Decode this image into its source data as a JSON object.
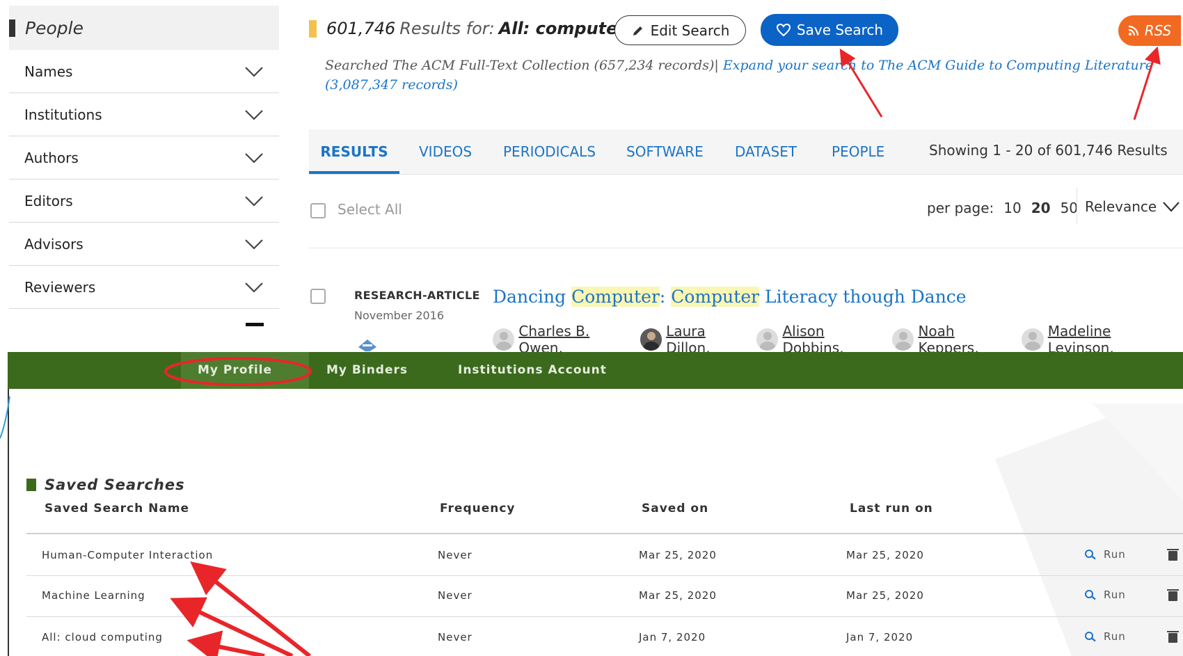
{
  "sidebar": {
    "heading": "People",
    "items": [
      {
        "label": "Names"
      },
      {
        "label": "Institutions"
      },
      {
        "label": "Authors"
      },
      {
        "label": "Editors"
      },
      {
        "label": "Advisors"
      },
      {
        "label": "Reviewers"
      }
    ]
  },
  "results": {
    "count": "601,746",
    "results_for": "Results for:",
    "query": "All: computer",
    "edit_label": "Edit Search",
    "save_label": "Save Search",
    "rss_label": "RSS",
    "searched_prefix": "Searched The ACM Full-Text Collection (657,234 records)|",
    "expand_link": "Expand your search to The ACM Guide to Computing Literature (3,087,347 records)"
  },
  "tabs": [
    {
      "label": "RESULTS",
      "active": true
    },
    {
      "label": "VIDEOS"
    },
    {
      "label": "PERIODICALS"
    },
    {
      "label": "SOFTWARE"
    },
    {
      "label": "DATASET"
    },
    {
      "label": "PEOPLE"
    }
  ],
  "showing": "Showing 1 - 20  of 601,746 Results",
  "listing": {
    "select_all": "Select All",
    "per_page_label": "per page:",
    "per_page_options": [
      "10",
      "20",
      "50"
    ],
    "per_page_selected": "20",
    "sort": "Relevance"
  },
  "article": {
    "type": "RESEARCH-ARTICLE",
    "date": "November 2016",
    "title_parts": [
      "Dancing ",
      "Computer",
      ": ",
      "Computer",
      " Literacy though Dance"
    ],
    "authors": [
      "Charles B. Owen,",
      "Laura Dillon,",
      "Alison Dobbins,",
      "Noah Keppers,",
      "Madeline Levinson,"
    ]
  },
  "account_nav": {
    "items": [
      "My Profile",
      "My Binders",
      "Institutions Account"
    ],
    "active": "My Profile"
  },
  "saved_searches": {
    "heading": "Saved Searches",
    "columns": [
      "Saved Search Name",
      "Frequency",
      "Saved on",
      "Last run on"
    ],
    "rows": [
      {
        "name": "Human-Computer Interaction",
        "frequency": "Never",
        "saved_on": "Mar 25, 2020",
        "last_run": "Mar 25, 2020",
        "action": "Run"
      },
      {
        "name": "Machine Learning",
        "frequency": "Never",
        "saved_on": "Mar 25, 2020",
        "last_run": "Mar 25, 2020",
        "action": "Run"
      },
      {
        "name": "All: cloud computing",
        "frequency": "Never",
        "saved_on": "Jan 7, 2020",
        "last_run": "Jan 7, 2020",
        "action": "Run"
      }
    ]
  },
  "colors": {
    "accent_blue": "#1a74c7",
    "save_button": "#0b63c6",
    "rss_button": "#f26a21",
    "nav_green": "#3b6a1d",
    "annotation_red": "#e8262a"
  },
  "icons": [
    "chevron-down-icon",
    "pencil-icon",
    "heart-icon",
    "rss-icon",
    "search-icon",
    "trash-icon",
    "open-access-icon"
  ]
}
